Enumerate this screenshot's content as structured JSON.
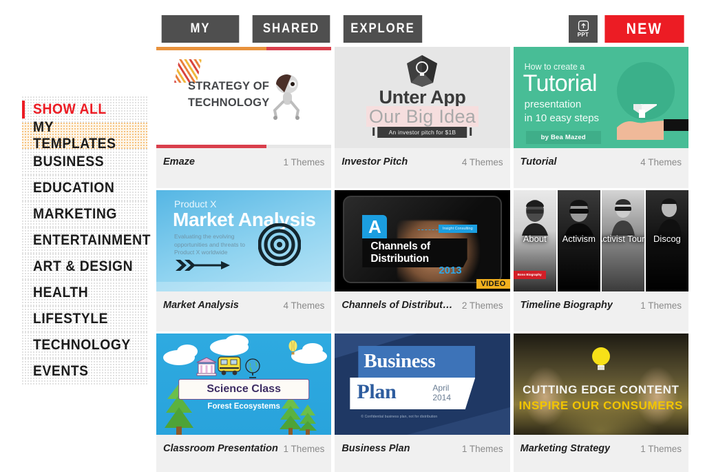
{
  "header": {
    "tabs": [
      {
        "label": "MY",
        "active": true
      },
      {
        "label": "SHARED",
        "active": false
      },
      {
        "label": "EXPLORE",
        "active": false
      }
    ],
    "ppt_button": {
      "label": "PPT",
      "icon": "upload-icon"
    },
    "new_button": {
      "label": "NEW",
      "color": "#ec1c24"
    }
  },
  "sidebar": {
    "items": [
      {
        "label": "SHOW ALL",
        "state": "active"
      },
      {
        "label": "MY TEMPLATES",
        "state": "highlight"
      },
      {
        "label": "BUSINESS",
        "state": "normal"
      },
      {
        "label": "EDUCATION",
        "state": "normal"
      },
      {
        "label": "MARKETING",
        "state": "normal"
      },
      {
        "label": "ENTERTAINMENT",
        "state": "normal"
      },
      {
        "label": "ART & DESIGN",
        "state": "normal"
      },
      {
        "label": "HEALTH",
        "state": "normal"
      },
      {
        "label": "LIFESTYLE",
        "state": "normal"
      },
      {
        "label": "TECHNOLOGY",
        "state": "normal"
      },
      {
        "label": "EVENTS",
        "state": "normal"
      }
    ]
  },
  "cards": [
    {
      "title": "Emaze",
      "themes": "1 Themes",
      "slide": {
        "heading": "STRATEGY OF TECHNOLOGY",
        "progress_top_percent": 63,
        "progress_bottom_percent": 63
      }
    },
    {
      "title": "Investor Pitch",
      "themes": "4 Themes",
      "slide": {
        "heading": "Unter App",
        "subheading": "Our Big Idea",
        "banner": "An investor pitch for $1B"
      }
    },
    {
      "title": "Tutorial",
      "themes": "4 Themes",
      "slide": {
        "pre": "How to create a",
        "big": "Tutorial",
        "line1": "presentation",
        "line2": "in 10 easy steps",
        "author": "by Bea Mazed",
        "bg_color": "#48bd96"
      }
    },
    {
      "title": "Market Analysis",
      "themes": "4 Themes",
      "slide": {
        "pre": "Product X",
        "big": "Market Analysis",
        "sub": "Evaluating the evolving opportunities and threats to Product X worldwide"
      }
    },
    {
      "title": "Channels of Distribut…",
      "themes": "2 Themes",
      "slide": {
        "letter": "A",
        "heading": "Channels of Distribution",
        "year": "2013",
        "tag": "Insight Consulting",
        "badge": "VIDEO"
      }
    },
    {
      "title": "Timeline Biography",
      "themes": "1 Themes",
      "slide": {
        "panels": [
          "About",
          "Activism",
          "Activist Tours",
          "Discog"
        ],
        "ribbon": "Bono Biography"
      }
    },
    {
      "title": "Classroom Presentation",
      "themes": "1 Themes",
      "slide": {
        "ribbon": "Science Class",
        "sub": "Forest Ecosystems"
      }
    },
    {
      "title": "Business Plan",
      "themes": "1 Themes",
      "slide": {
        "word1": "Business",
        "word2": "Plan",
        "month": "April",
        "year": "2014",
        "footer": "© Confidential business plan, not for distribution"
      }
    },
    {
      "title": "Marketing Strategy",
      "themes": "1 Themes",
      "slide": {
        "line1": "CUTTING EDGE CONTENT",
        "line2": "INSPIRE OUR CONSUMERS"
      }
    }
  ]
}
